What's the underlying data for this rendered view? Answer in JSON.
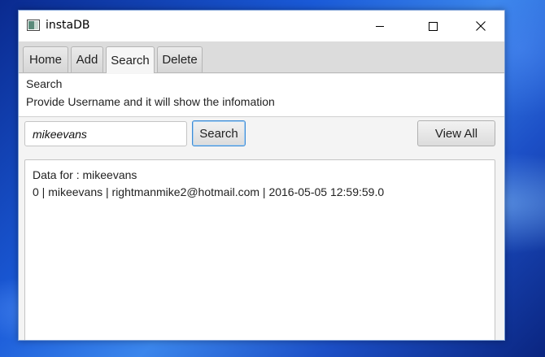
{
  "window": {
    "title": "instaDB",
    "controls": {
      "minimize": "minimize",
      "maximize": "maximize",
      "close": "✕"
    }
  },
  "tabs": [
    {
      "label": "Home",
      "active": false
    },
    {
      "label": "Add",
      "active": false
    },
    {
      "label": "Search",
      "active": true
    },
    {
      "label": "Delete",
      "active": false
    }
  ],
  "search_page": {
    "title": "Search",
    "description": "Provide Username and it will show the infomation",
    "username_value": "mikeevans",
    "search_button": "Search",
    "view_all_button": "View All",
    "results": {
      "header": "Data for : mikeevans",
      "rows": [
        "0 | mikeevans | rightmanmike2@hotmail.com | 2016-05-05 12:59:59.0"
      ]
    }
  },
  "colors": {
    "focus_border": "#3d8bd4",
    "window_bg": "#f4f4f4",
    "desktop_blue": "#1a5ad8"
  }
}
